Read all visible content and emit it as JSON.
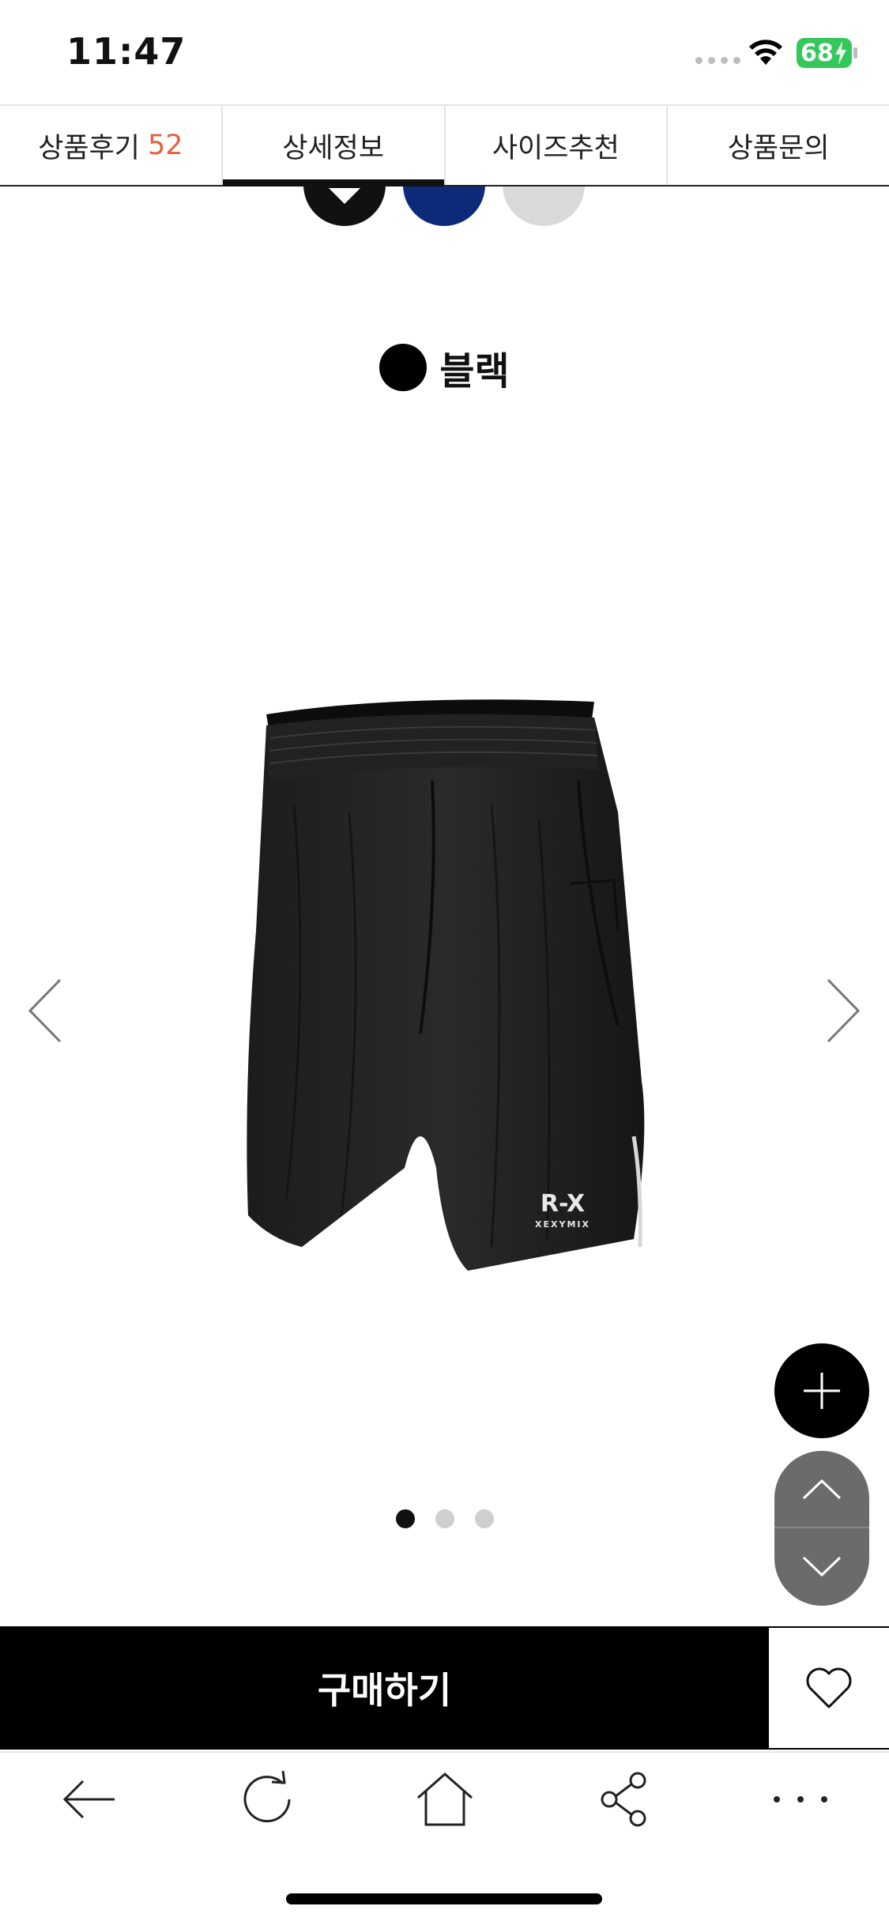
{
  "status_bar": {
    "time": "11:47",
    "battery": "68"
  },
  "tabs": [
    {
      "label": "상품후기",
      "count": "52"
    },
    {
      "label": "상세정보",
      "count": ""
    },
    {
      "label": "사이즈추천",
      "count": ""
    },
    {
      "label": "상품문의",
      "count": ""
    }
  ],
  "active_tab": "상세정보",
  "swatches": [
    {
      "name": "black",
      "color": "#111111",
      "selected": true
    },
    {
      "name": "navy",
      "color": "#0d2a78",
      "selected": false
    },
    {
      "name": "gray",
      "color": "#d9d9d9",
      "selected": false
    }
  ],
  "selected_color": {
    "name": "블랙",
    "color": "#000000"
  },
  "product": {
    "logo_text": "R-X",
    "brand": "XEXYMIX"
  },
  "carousel": {
    "total": 3,
    "current": 1
  },
  "purchase": {
    "buy_label": "구매하기"
  },
  "toolbar": {
    "icons": [
      "back-arrow-icon",
      "refresh-icon",
      "home-icon",
      "share-icon",
      "more-icon"
    ]
  }
}
